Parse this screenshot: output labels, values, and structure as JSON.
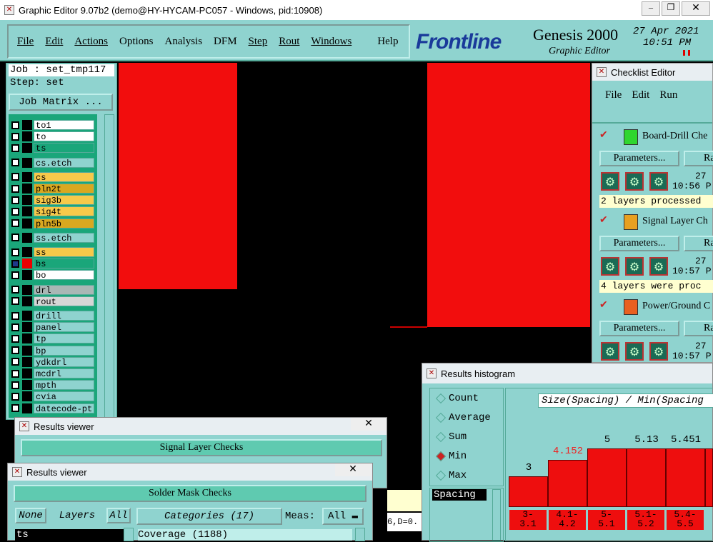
{
  "window": {
    "title": "Graphic Editor 9.07b2 (demo@HY-HYCAM-PC057 - Windows, pid:10908)"
  },
  "menu": [
    "File",
    "Edit",
    "Actions",
    "Options",
    "Analysis",
    "DFM",
    "Step",
    "Rout",
    "Windows",
    "Help"
  ],
  "brand": {
    "logo": "Frontline",
    "product": "Genesis 2000",
    "subtitle": "Graphic Editor",
    "date": "27 Apr 2021",
    "time": "10:51 PM"
  },
  "job": {
    "label": "Job : set_tmp117",
    "step": "Step: set",
    "matrix_button": "Job Matrix ..."
  },
  "layers": [
    {
      "name": "to1",
      "color": "#ffffff"
    },
    {
      "name": "to",
      "color": "#ffffff"
    },
    {
      "name": "ts",
      "color": "#1aa67a"
    },
    {
      "name": "cs.etch",
      "color": "#8fd3cf"
    },
    {
      "name": "cs",
      "color": "#f7c94a"
    },
    {
      "name": "pln2t",
      "color": "#d9a820"
    },
    {
      "name": "sig3b",
      "color": "#f7c94a"
    },
    {
      "name": "sig4t",
      "color": "#f7c94a"
    },
    {
      "name": "pln5b",
      "color": "#d9a820"
    },
    {
      "name": "ss.etch",
      "color": "#8fd3cf"
    },
    {
      "name": "ss",
      "color": "#f7c94a"
    },
    {
      "name": "bs",
      "color": "#1aa67a"
    },
    {
      "name": "bo",
      "color": "#ffffff"
    },
    {
      "name": "drl",
      "color": "#a9b7b5"
    },
    {
      "name": "rout",
      "color": "#d6d6d6"
    },
    {
      "name": "drill",
      "color": "#8fd3cf"
    },
    {
      "name": "panel",
      "color": "#8fd3cf"
    },
    {
      "name": "tp",
      "color": "#8fd3cf"
    },
    {
      "name": "bp",
      "color": "#8fd3cf"
    },
    {
      "name": "ydkdrl",
      "color": "#8fd3cf"
    },
    {
      "name": "mcdrl",
      "color": "#8fd3cf"
    },
    {
      "name": "mpth",
      "color": "#8fd3cf"
    },
    {
      "name": "cvia",
      "color": "#8fd3cf"
    },
    {
      "name": "datecode-pt",
      "color": "#8fd3cf"
    }
  ],
  "checklist": {
    "title": "Checklist Editor",
    "menu": [
      "File",
      "Edit",
      "Run"
    ],
    "checks": [
      {
        "name": "Board-Drill Che",
        "params": "Parameters...",
        "run": "Ra",
        "date": "27",
        "time": "10:56 P",
        "status": "2 layers processed"
      },
      {
        "name": "Signal Layer Ch",
        "params": "Parameters...",
        "run": "Ra",
        "date": "27",
        "time": "10:57 P",
        "status": "4 layers were proc"
      },
      {
        "name": "Power/Ground C",
        "params": "Parameters...",
        "run": "Ra",
        "date": "27",
        "time": "10:57 P",
        "status": ""
      }
    ]
  },
  "results_back": {
    "title": "Results viewer",
    "header": "Signal Layer Checks"
  },
  "results_front": {
    "title": "Results viewer",
    "header": "Solder Mask Checks",
    "none": "None",
    "layers": "Layers",
    "all": "All",
    "categories": "Categories (17)",
    "meas_label": "Meas:",
    "meas_value": "All",
    "layer_value": "ts",
    "category_item": "Coverage (1188)"
  },
  "coord": "6,D=0.",
  "histogram": {
    "title": "Results histogram",
    "options": [
      "Count",
      "Average",
      "Sum",
      "Min",
      "Max"
    ],
    "selected": "Min",
    "list_item": "Spacing",
    "chart_title": "Size(Spacing) / Min(Spacing"
  },
  "chart_data": {
    "type": "bar",
    "title": "Size(Spacing) / Min(Spacing",
    "categories": [
      "3-\n3.1",
      "4.1-\n4.2",
      "5-\n5.1",
      "5.1-\n5.2",
      "5.4-\n5.5"
    ],
    "values": [
      3,
      4.152,
      5,
      5.13,
      5.451
    ],
    "labels": [
      "3",
      "4.152",
      "5",
      "5.13",
      "5.451"
    ],
    "highlight_index": 1,
    "highlight_color": "#ee2222",
    "bar_color": "#ee0e0e",
    "ylim": [
      0,
      5.6
    ]
  },
  "colors": {
    "panel": "#8fd3cf",
    "accent": "#1aa67a",
    "canvas": "#000000",
    "copper": "#f20d0d"
  }
}
